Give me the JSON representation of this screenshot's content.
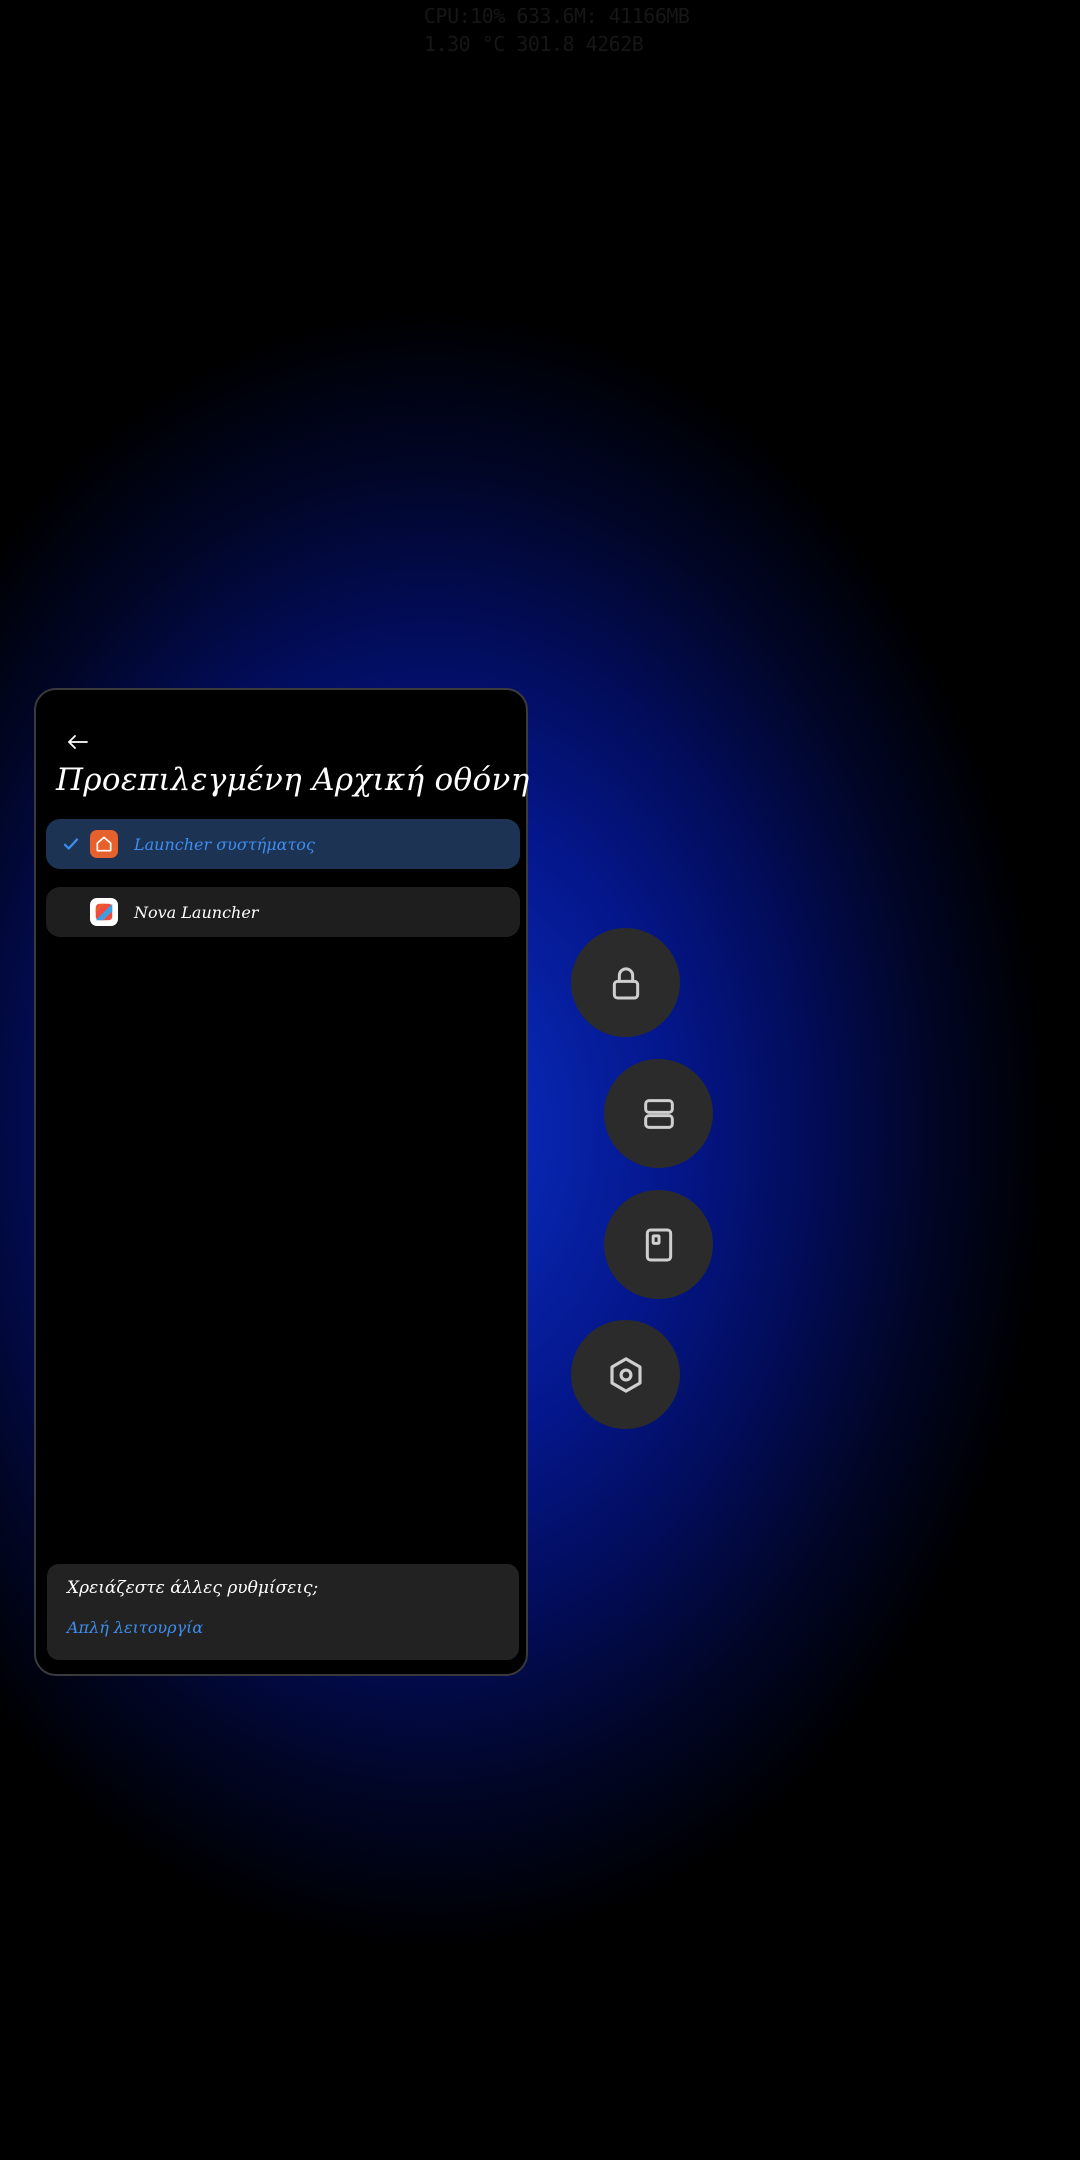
{
  "overlay": {
    "line1": "CPU:10% 633.6M: 41166MB",
    "line2": "1.30 °C 301.8 4262B"
  },
  "panel": {
    "title": "Προεπιλεγμένη Αρχική οθόνη",
    "launchers": [
      {
        "label": "Launcher συστήματος",
        "selected": true,
        "icon": "home-icon"
      },
      {
        "label": "Nova Launcher",
        "selected": false,
        "icon": "nova-launcher-icon"
      }
    ],
    "footer": {
      "question": "Χρειάζεστε άλλες ρυθμίσεις;",
      "link": "Απλή λειτουργία"
    }
  },
  "floating_buttons": [
    {
      "icon": "lock-icon"
    },
    {
      "icon": "split-screen-icon"
    },
    {
      "icon": "floating-window-icon"
    },
    {
      "icon": "settings-icon"
    }
  ],
  "colors": {
    "accent": "#3d8ef0",
    "selected_row_bg": "#1c3354",
    "row_bg": "#1e1e1e",
    "fab_bg": "#2b2b2b",
    "system_icon_bg": "#e6612b"
  }
}
